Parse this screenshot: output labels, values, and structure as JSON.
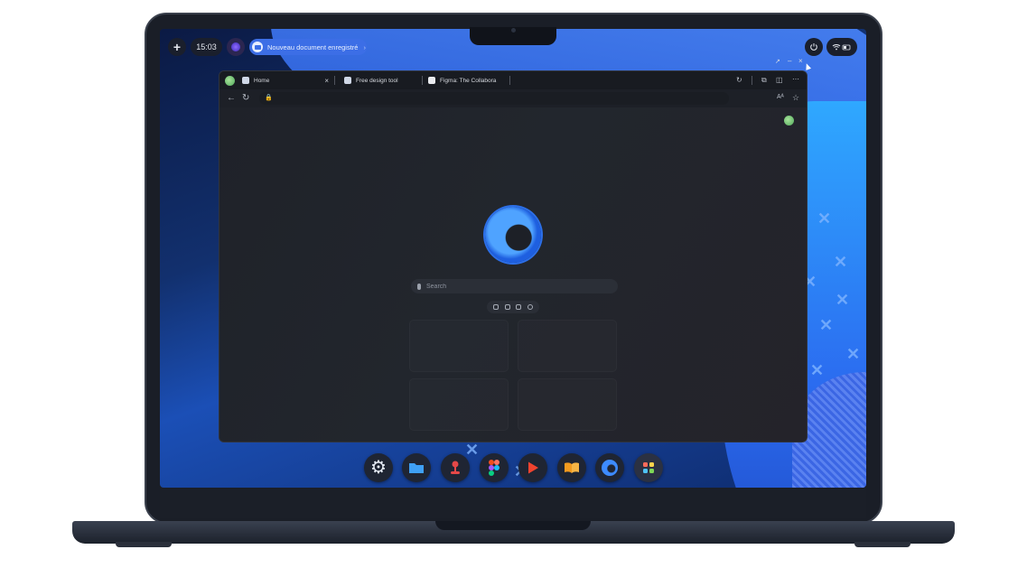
{
  "topbar": {
    "add_label": "+",
    "clock": "15:03",
    "notification": "Nouveau document enregistré",
    "notification_chevron": "›"
  },
  "window_controls": {
    "move": "↗",
    "minimize": "–",
    "close": "×"
  },
  "browser": {
    "tabs": [
      {
        "title": "Home",
        "close": "×"
      },
      {
        "title": "Free design tool"
      },
      {
        "title": "Figma: The Collabora"
      }
    ],
    "address_value": "",
    "search_placeholder": "Search",
    "reader_label": "Aᴬ"
  },
  "dock": {
    "apps": [
      {
        "name": "settings-app",
        "icon": "gear",
        "color": "#e8edf7",
        "glyph": "⚙"
      },
      {
        "name": "files-app",
        "icon": "folder",
        "color": "#3fa0f5",
        "glyph": ""
      },
      {
        "name": "joystick-app",
        "icon": "joystick",
        "color": "#e54848",
        "glyph": ""
      },
      {
        "name": "figma-app",
        "icon": "figma",
        "color": "#f24e1e",
        "glyph": ""
      },
      {
        "name": "video-app",
        "icon": "play",
        "color": "#f0432f",
        "glyph": ""
      },
      {
        "name": "books-app",
        "icon": "book",
        "color": "#f29a1f",
        "glyph": ""
      },
      {
        "name": "browser-app",
        "icon": "browser",
        "color": "#3d8bff",
        "glyph": ""
      },
      {
        "name": "app-grid",
        "icon": "grid",
        "color": "#4a5266",
        "glyph": ""
      }
    ]
  },
  "colors": {
    "accent": "#3c6ee6",
    "window_bg": "#1d2027",
    "tab_bar": "#181b21"
  }
}
